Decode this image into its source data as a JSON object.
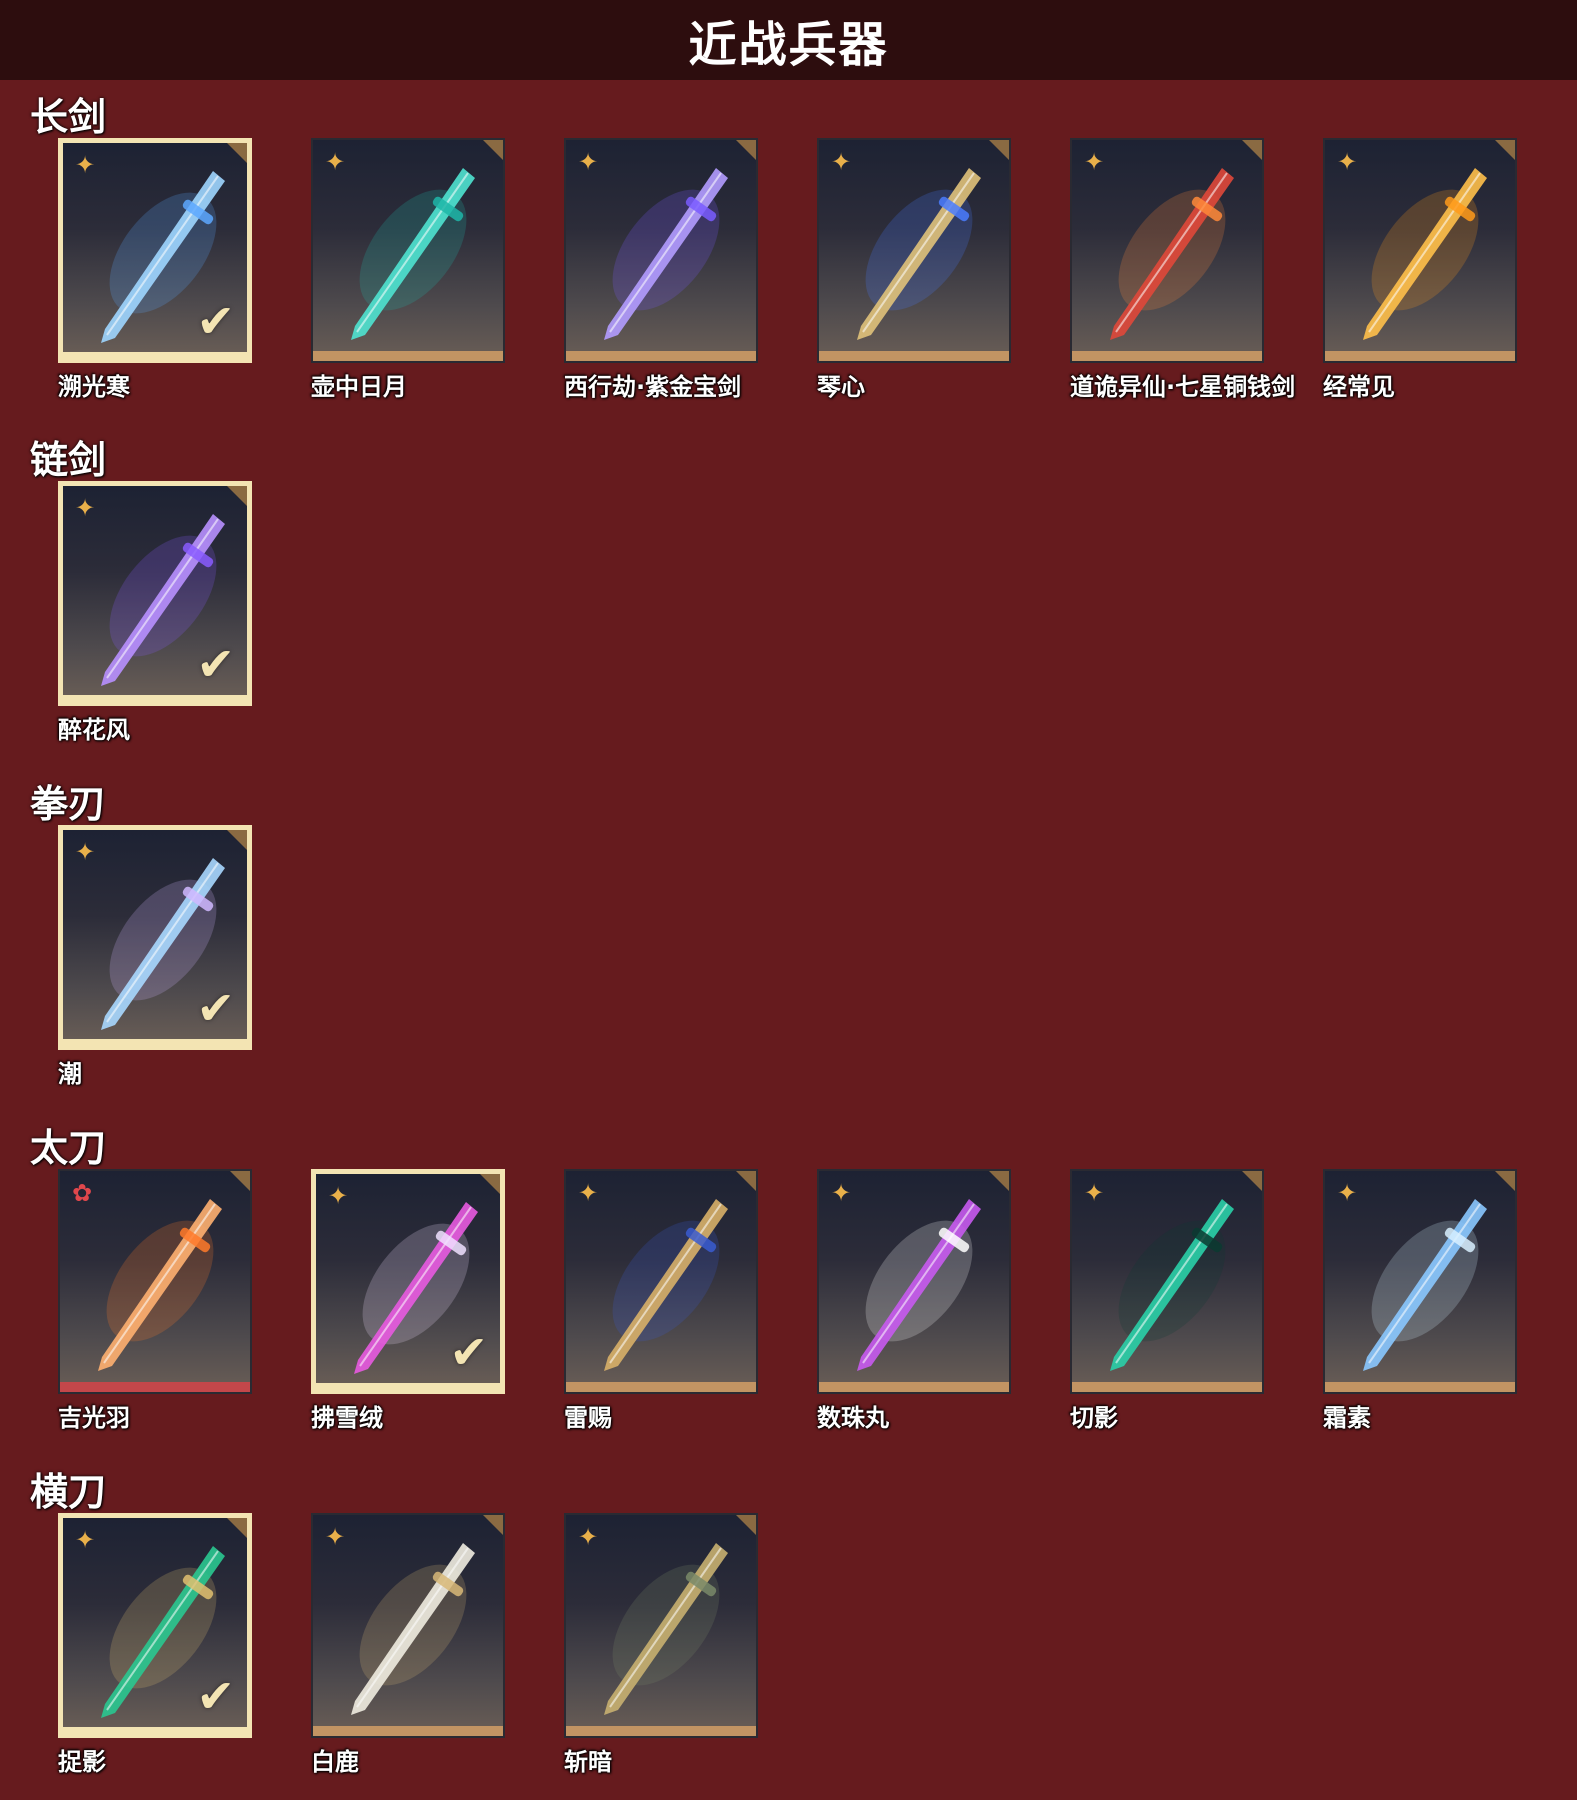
{
  "header": {
    "title": "近战兵器"
  },
  "sections": [
    {
      "title": "长剑",
      "items": [
        {
          "name": "溯光寒",
          "selected": true,
          "rarity": "gold",
          "color": "#9fd6ff",
          "glow": "#5da8ff"
        },
        {
          "name": "壶中日月",
          "selected": false,
          "rarity": "gold",
          "color": "#4fe3d0",
          "glow": "#1fb6a8"
        },
        {
          "name": "西行劫·紫金宝剑",
          "selected": false,
          "rarity": "gold",
          "color": "#b39cff",
          "glow": "#7a5cff"
        },
        {
          "name": "琴心",
          "selected": false,
          "rarity": "gold",
          "color": "#e0c27a",
          "glow": "#4a7cff"
        },
        {
          "name": "道诡异仙·七星铜钱剑",
          "selected": false,
          "rarity": "gold",
          "color": "#e0483a",
          "glow": "#ff8a3a"
        },
        {
          "name": "经常见",
          "selected": false,
          "rarity": "gold",
          "color": "#ffc04a",
          "glow": "#ff9a1a"
        }
      ]
    },
    {
      "title": "链剑",
      "items": [
        {
          "name": "醉花风",
          "selected": true,
          "rarity": "gold",
          "color": "#b890ff",
          "glow": "#8a5cff"
        }
      ]
    },
    {
      "title": "拳刃",
      "items": [
        {
          "name": "潮",
          "selected": true,
          "rarity": "gold",
          "color": "#a8d8ff",
          "glow": "#d0b8ff"
        }
      ]
    },
    {
      "title": "太刀",
      "items": [
        {
          "name": "吉光羽",
          "selected": false,
          "rarity": "red",
          "color": "#ffb070",
          "glow": "#ff7a2a"
        },
        {
          "name": "拂雪绒",
          "selected": true,
          "rarity": "gold",
          "color": "#e85ae0",
          "glow": "#f0e0ff"
        },
        {
          "name": "雷赐",
          "selected": false,
          "rarity": "gold",
          "color": "#d8b068",
          "glow": "#3a5cd0"
        },
        {
          "name": "数珠丸",
          "selected": false,
          "rarity": "gold",
          "color": "#c85af0",
          "glow": "#ffffff"
        },
        {
          "name": "切影",
          "selected": false,
          "rarity": "gold",
          "color": "#2ad0a8",
          "glow": "#0a3a30"
        },
        {
          "name": "霜素",
          "selected": false,
          "rarity": "gold",
          "color": "#8ac8ff",
          "glow": "#d8f0ff"
        }
      ]
    },
    {
      "title": "横刀",
      "items": [
        {
          "name": "捉影",
          "selected": true,
          "rarity": "gold",
          "color": "#2ac890",
          "glow": "#e0c070"
        },
        {
          "name": "白鹿",
          "selected": false,
          "rarity": "gold",
          "color": "#f0ece0",
          "glow": "#d8b878"
        },
        {
          "name": "斩暗",
          "selected": false,
          "rarity": "gold",
          "color": "#c8b070",
          "glow": "#7a8a68"
        }
      ]
    }
  ]
}
